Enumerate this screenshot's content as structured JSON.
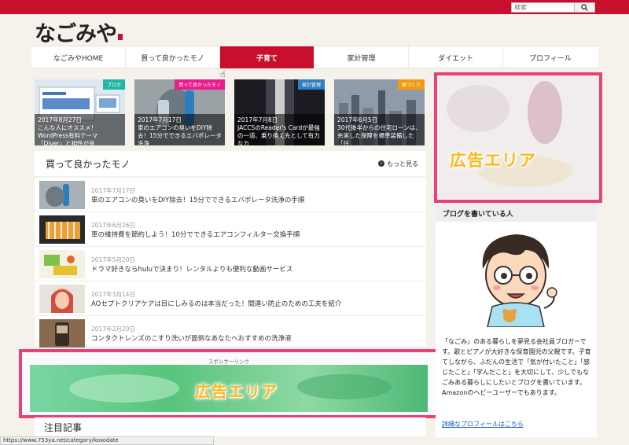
{
  "search": {
    "placeholder": "検索"
  },
  "logo": {
    "text": "なごみや"
  },
  "nav": {
    "items": [
      {
        "label": "なごみやHOME"
      },
      {
        "label": "買って良かったモノ"
      },
      {
        "label": "子育て"
      },
      {
        "label": "家計管理"
      },
      {
        "label": "ダイエット"
      },
      {
        "label": "プロフィール"
      }
    ],
    "active_index": 2
  },
  "cards": [
    {
      "category": "ブログ",
      "category_color": "#1fb8a6",
      "date": "2017年8月27日",
      "title": "こんな人にオススメ！WordPress有料テーマ「Diver」と相性が良"
    },
    {
      "category": "買って良かったモノ",
      "category_color": "#e91e8c",
      "date": "2017年7月17日",
      "title": "車のエアコンの臭いをDIY除去！15分でできるエバポレータ洗浄"
    },
    {
      "category": "家計管理",
      "category_color": "#2f7fc4",
      "date": "2017年7月8日",
      "title": "JACCSのReader's Cardが最強の一道、乗り換え先として有力なカ"
    },
    {
      "category": "家づくり",
      "category_color": "#f39c12",
      "date": "2017年6月5日",
      "title": "30代後半からの住宅ローンは、充実した保障を標準装備した「住"
    }
  ],
  "section": {
    "title": "買って良かったモノ",
    "more": "もっと見る"
  },
  "list": [
    {
      "date": "2017年7月17日",
      "title": "車のエアコンの臭いをDIY除去！15分でできるエバポレータ洗浄の手順"
    },
    {
      "date": "2017年6月26日",
      "title": "車の維持費を節約しよう！10分でできるエアコンフィルター交換手順"
    },
    {
      "date": "2017年5月20日",
      "title": "ドラマ好きならhuluで決まり！レンタルよりも便利な動画サービス"
    },
    {
      "date": "2017年3月14日",
      "title": "AOセプトクリアケアは目にしみるのは本当だった！間違い防止のための工夫を紹介"
    },
    {
      "date": "2017年2月20日",
      "title": "コンタクトレンズのこすり洗いが面倒なあなたへおすすめの洗浄液"
    }
  ],
  "ads": {
    "sponsor": "スポンサーリンク",
    "label": "広告エリア"
  },
  "attention": {
    "title": "注目記事"
  },
  "profile": {
    "header": "ブログを書いている人",
    "bio": "「なごみ」のある暮らしを夢見る会社員ブロガーです。歌とピアノが大好きな保育園児の父親です。子育てしながら、ふだんの生活で「気が付いたこと」「感じたこと」「学んだこと」を大切にして、少しでもなごみある暮らしにしたいとブログを書いています。",
    "bio2": "Amazonのヘビーユーザーでもあります。",
    "link": "詳細なプロフィールはこちら"
  },
  "status": {
    "url": "https://www.753ya.net/category/kosodate"
  },
  "colors": {
    "brand": "#c8102e",
    "ad_border": "#e8407a",
    "ad_text": "#ffb81c"
  }
}
